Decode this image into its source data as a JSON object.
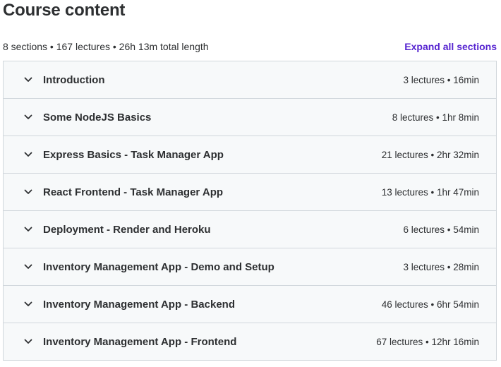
{
  "header": {
    "title": "Course content",
    "summary": "8 sections • 167 lectures • 26h 13m total length",
    "expand_all_label": "Expand all sections"
  },
  "sections": [
    {
      "title": "Introduction",
      "meta": "3 lectures • 16min"
    },
    {
      "title": "Some NodeJS Basics",
      "meta": "8 lectures • 1hr 8min"
    },
    {
      "title": "Express Basics - Task Manager App",
      "meta": "21 lectures • 2hr 32min"
    },
    {
      "title": "React Frontend - Task Manager App",
      "meta": "13 lectures • 1hr 47min"
    },
    {
      "title": "Deployment - Render and Heroku",
      "meta": "6 lectures • 54min"
    },
    {
      "title": "Inventory Management App - Demo and Setup",
      "meta": "3 lectures • 28min"
    },
    {
      "title": "Inventory Management App - Backend",
      "meta": "46 lectures • 6hr 54min"
    },
    {
      "title": "Inventory Management App - Frontend",
      "meta": "67 lectures • 12hr 16min"
    }
  ],
  "icons": {
    "section_toggle": "chevron-down-icon"
  },
  "colors": {
    "accent": "#5624d0",
    "row_background": "#f7f9fa",
    "border": "#d1d7dc",
    "text": "#2d2f31"
  }
}
